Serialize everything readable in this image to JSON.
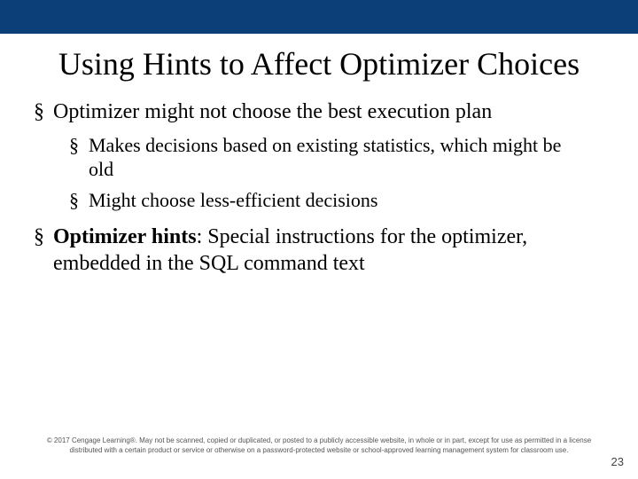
{
  "title": "Using Hints to Affect Optimizer Choices",
  "bullets": {
    "b1": "Optimizer might not choose the best execution plan",
    "b1a": "Makes decisions based on existing statistics, which might be old",
    "b1b": "Might choose less-efficient decisions",
    "b2_strong": "Optimizer hints",
    "b2_rest": ": Special instructions for the optimizer, embedded in the SQL command text"
  },
  "footer": "© 2017 Cengage Learning®. May not be scanned, copied or duplicated, or posted to a publicly accessible website, in whole or in part, except for use as permitted in a license distributed with a certain product or service or otherwise on a password-protected website or school-approved learning management system for classroom use.",
  "page_number": "23"
}
